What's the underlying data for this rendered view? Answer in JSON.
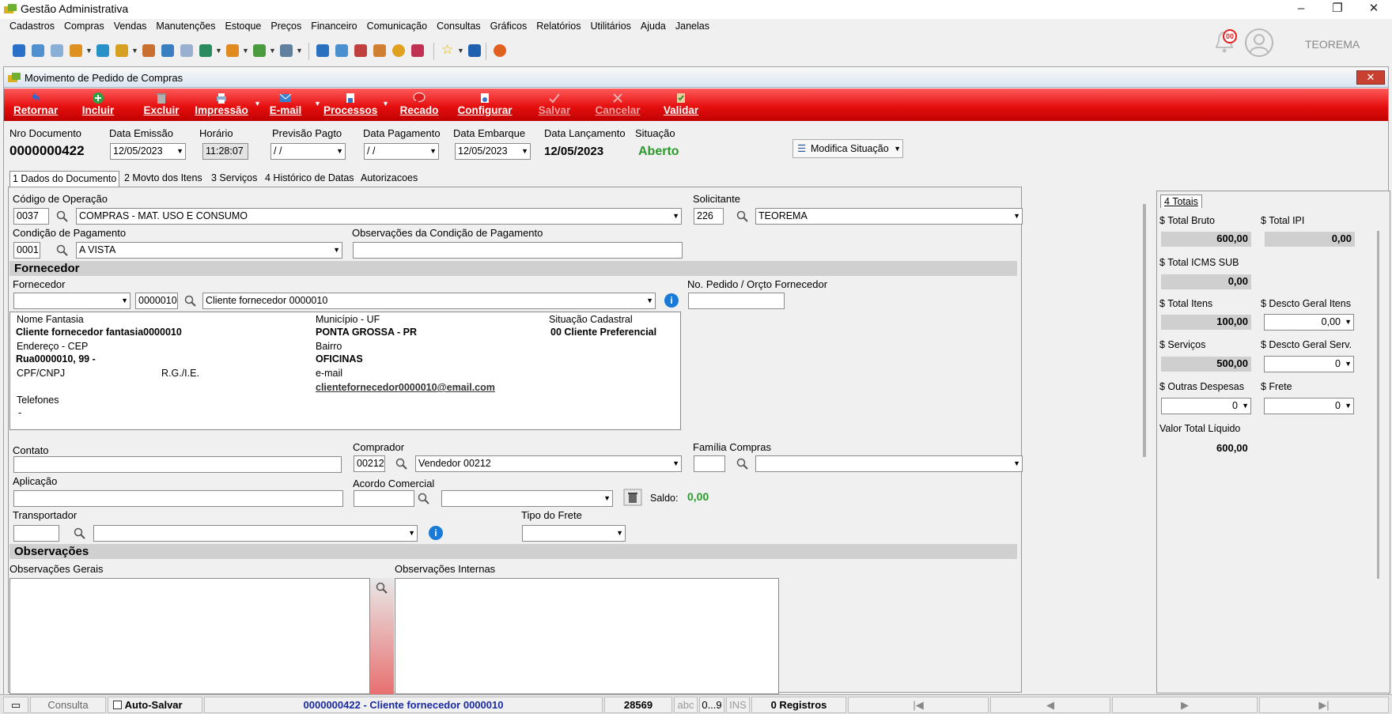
{
  "window": {
    "title": "Gestão Administrativa",
    "minimize": "–",
    "restore": "❐",
    "close": "✕"
  },
  "menu": [
    "Cadastros",
    "Compras",
    "Vendas",
    "Manutenções",
    "Estoque",
    "Preços",
    "Financeiro",
    "Comunicação",
    "Consultas",
    "Gráficos",
    "Relatórios",
    "Utilitários",
    "Ajuda",
    "Janelas"
  ],
  "notifications": {
    "count": "00"
  },
  "company": "TEOREMA",
  "form": {
    "title": "Movimento de Pedido de Compras",
    "close": "✕",
    "toolbar": {
      "retornar": "Retornar",
      "incluir": "Incluir",
      "excluir": "Excluir",
      "impressao": "Impressão",
      "email": "E-mail",
      "processos": "Processos",
      "recado": "Recado",
      "configurar": "Configurar",
      "salvar": "Salvar",
      "cancelar": "Cancelar",
      "validar": "Validar"
    },
    "header": {
      "nro_label": "Nro Documento",
      "nro": "0000000422",
      "emissao_label": "Data Emissão",
      "emissao": "12/05/2023",
      "horario_label": "Horário",
      "horario": "11:28:07",
      "previsao_label": "Previsão Pagto",
      "previsao": " / /",
      "pagamento_label": "Data Pagamento",
      "pagamento": " / /",
      "embarque_label": "Data Embarque",
      "embarque": "12/05/2023",
      "lancamento_label": "Data Lançamento",
      "lancamento": "12/05/2023",
      "situacao_label": "Situação",
      "situacao": "Aberto",
      "modifica": "Modifica Situação"
    },
    "tabs": [
      "1 Dados do Documento",
      "2 Movto dos Itens",
      "3 Serviços",
      "4 Histórico de Datas",
      "Autorizacoes"
    ],
    "dados": {
      "cod_op_label": "Código de Operação",
      "cod_op": "0037",
      "cod_op_desc": "COMPRAS  - MAT. USO E CONSUMO",
      "solicitante_label": "Solicitante",
      "solicitante_cod": "226",
      "solicitante": "TEOREMA",
      "cond_label": "Condição de Pagamento",
      "cond_cod": "0001",
      "cond_desc": "A VISTA",
      "obs_cond_label": "Observações da Condição de Pagamento",
      "fornecedor_section": "Fornecedor",
      "fornecedor_label": "Fornecedor",
      "fornecedor_cod": "0000010",
      "fornecedor_nome": "Cliente fornecedor 0000010",
      "pedido_label": "No. Pedido / Orçto Fornecedor",
      "info": {
        "nome_fantasia_label": "Nome Fantasia",
        "nome_fantasia": "Cliente fornecedor fantasia0000010",
        "municipio_label": "Município - UF",
        "municipio": "PONTA GROSSA - PR",
        "situacao_label": "Situação Cadastral",
        "situacao": "00 Cliente Preferencial",
        "endereco_label": "Endereço - CEP",
        "endereco": "Rua0000010, 99 -",
        "bairro_label": "Bairro",
        "bairro": "OFICINAS",
        "cpf_label": "CPF/CNPJ",
        "rg_label": "R.G./I.E.",
        "email_label": "e-mail",
        "email": "clientefornecedor0000010@email.com",
        "telefones_label": "Telefones",
        "telefones": "-"
      },
      "contato_label": "Contato",
      "comprador_label": "Comprador",
      "comprador_cod": "00212",
      "comprador": "Vendedor 00212",
      "familia_label": "Família Compras",
      "aplicacao_label": "Aplicação",
      "acordo_label": "Acordo Comercial",
      "saldo_label": "Saldo:",
      "saldo": "0,00",
      "transportador_label": "Transportador",
      "tipo_frete_label": "Tipo do Frete",
      "obs_section": "Observações",
      "obs_gerais_label": "Observações Gerais",
      "obs_internas_label": "Observações Internas"
    },
    "totais": {
      "tab": "4 Totais",
      "total_bruto_label": "$ Total Bruto",
      "total_bruto": "600,00",
      "total_ipi_label": "$ Total IPI",
      "total_ipi": "0,00",
      "total_icms_label": "$ Total ICMS SUB",
      "total_icms": "0,00",
      "total_itens_label": "$ Total Itens",
      "total_itens": "100,00",
      "desc_itens_label": "$ Descto Geral Itens",
      "desc_itens": "0,00",
      "servicos_label": "$ Serviços",
      "servicos": "500,00",
      "desc_serv_label": "$ Descto Geral Serv.",
      "desc_serv": "0",
      "outras_label": "$ Outras Despesas",
      "outras": "0",
      "frete_label": "$ Frete",
      "frete": "0",
      "liquido_label": "Valor Total Líquido",
      "liquido": "600,00"
    }
  },
  "status": {
    "mode": "Consulta",
    "autosave": "Auto-Salvar",
    "record": "0000000422 - Cliente fornecedor 0000010",
    "code": "28569",
    "abc": "abc",
    "num": "0...9",
    "ins": "INS",
    "registros": "0 Registros",
    "first": "|◀",
    "prev": "◀",
    "next": "▶",
    "last": "▶|"
  }
}
